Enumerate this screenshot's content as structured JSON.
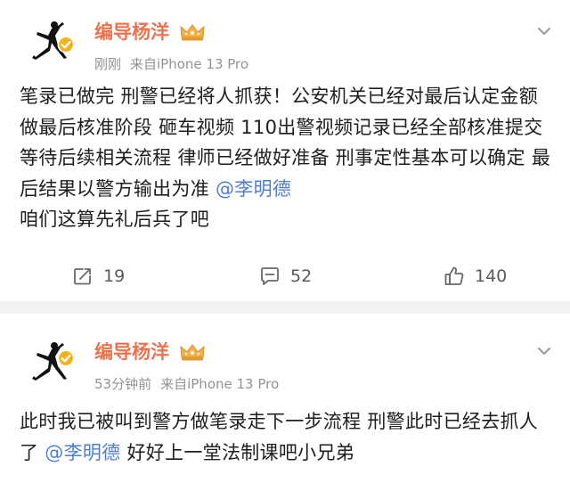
{
  "posts": [
    {
      "username": "编导杨洋",
      "time": "刚刚",
      "source": "来自iPhone 13 Pro",
      "text_before": "笔录已做完 刑警已经将人抓获！公安机关已经对最后认定金额做最后核准阶段 砸车视频 110出警视频记录已经全部核准提交  等待后续相关流程 律师已经做好准备 刑事定性基本可以确定 最后结果以警方输出为准 ",
      "mention": "@李明德",
      "text_after": "咱们这算先礼后兵了吧",
      "reposts": "19",
      "comments": "52",
      "likes": "140"
    },
    {
      "username": "编导杨洋",
      "time": "53分钟前",
      "source": "来自iPhone 13 Pro",
      "text_before": "此时我已被叫到警方做笔录走下一步流程 刑警此时已经去抓人了 ",
      "mention": "@李明德",
      "text_after": " 好好上一堂法制课吧小兄弟"
    }
  ],
  "icons": {
    "avatar": "jumpman-logo",
    "verified": "verified-badge-icon",
    "crown": "crown-icon",
    "more": "chevron-down-icon",
    "repost": "repost-icon",
    "comment": "comment-icon",
    "like": "thumbs-up-icon"
  },
  "colors": {
    "username": "#eb7350",
    "mention": "#4f7ed2",
    "meta": "#939393",
    "verified": "#f6b21d",
    "separator": "#f2f2f2"
  }
}
